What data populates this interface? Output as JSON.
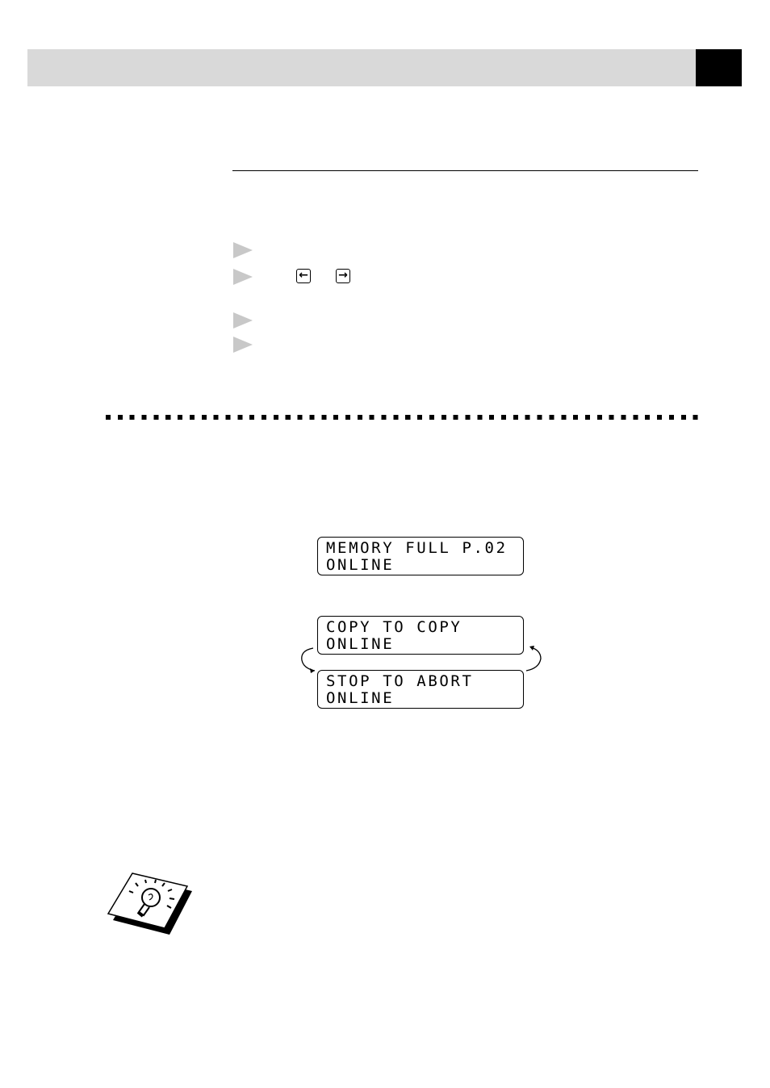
{
  "header": {
    "accent": "#d9d9d9",
    "tab_color": "#000000"
  },
  "keys": {
    "left_arrow": "←",
    "right_arrow": "→"
  },
  "displays": [
    {
      "line1": "MEMORY FULL P.02",
      "line2": "ONLINE"
    },
    {
      "line1": "COPY TO COPY",
      "line2": "ONLINE"
    },
    {
      "line1": "STOP TO ABORT",
      "line2": "ONLINE"
    }
  ],
  "icons": {
    "bullet": "triangle-right-icon",
    "note": "lightbulb-icon"
  }
}
